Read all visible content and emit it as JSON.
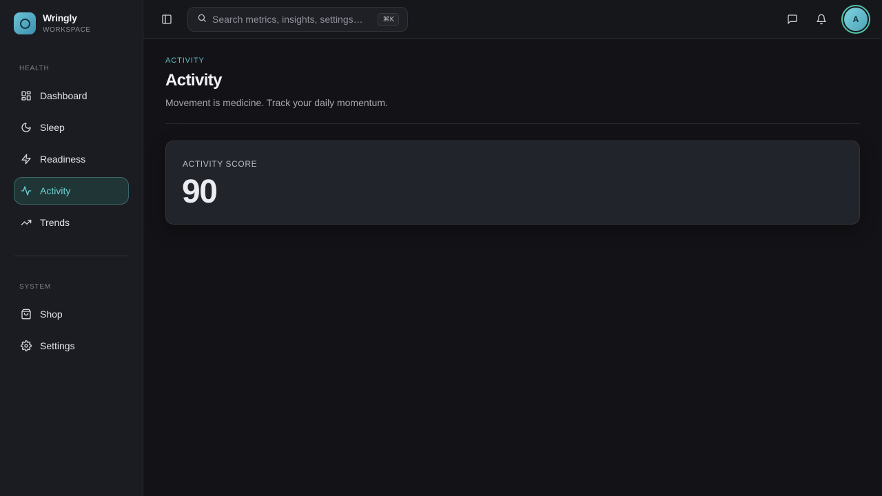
{
  "brand": {
    "name": "Wringly",
    "subtitle": "WORKSPACE"
  },
  "sidebar": {
    "sections": [
      {
        "label": "HEALTH"
      },
      {
        "label": "SYSTEM"
      }
    ],
    "items": [
      {
        "label": "Dashboard",
        "icon": "dashboard-icon"
      },
      {
        "label": "Sleep",
        "icon": "moon-icon"
      },
      {
        "label": "Readiness",
        "icon": "lightning-icon"
      },
      {
        "label": "Activity",
        "icon": "activity-icon",
        "active": true
      },
      {
        "label": "Trends",
        "icon": "trending-up-icon"
      },
      {
        "label": "Shop",
        "icon": "shopping-bag-icon"
      },
      {
        "label": "Settings",
        "icon": "gear-icon"
      }
    ]
  },
  "topbar": {
    "search_placeholder": "Search metrics, insights, settings…",
    "shortcut": "⌘K",
    "avatar_initial": "A"
  },
  "page": {
    "eyebrow": "ACTIVITY",
    "title": "Activity",
    "subtitle": "Movement is medicine. Track your daily momentum."
  },
  "score_card": {
    "label": "ACTIVITY SCORE",
    "value": "90"
  },
  "colors": {
    "accent": "#6fd3d5",
    "active_bg": "#1f3536",
    "avatar_ring": "#4fc4a7"
  }
}
